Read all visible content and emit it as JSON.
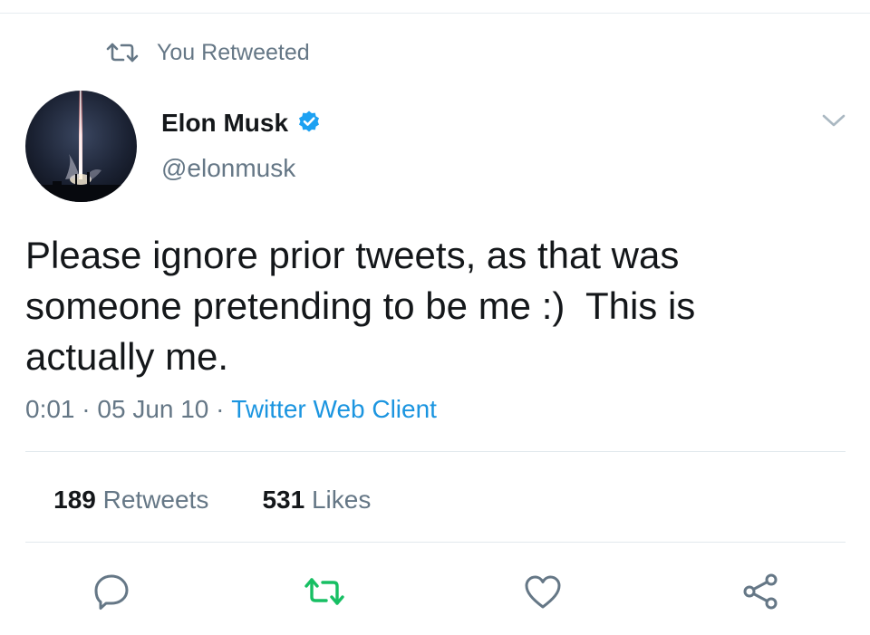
{
  "retweet_context": {
    "label": "You Retweeted",
    "icon": "retweet-icon"
  },
  "author": {
    "name": "Elon Musk",
    "handle": "@elonmusk",
    "verified": true,
    "verified_icon": "verified-badge-icon",
    "avatar": "rocket-launch-avatar"
  },
  "menu": {
    "icon": "chevron-down-icon"
  },
  "tweet": {
    "text": "Please ignore prior tweets, as that was someone pretending to be me :)  This is actually me.",
    "time": "0:01",
    "date": "05 Jun 10",
    "separator": " · ",
    "source": "Twitter Web Client"
  },
  "stats": {
    "retweets_count": "189",
    "retweets_label": " Retweets",
    "likes_count": "531",
    "likes_label": " Likes"
  },
  "actions": {
    "reply_icon": "reply-icon",
    "retweet_icon": "retweet-icon",
    "like_icon": "heart-icon",
    "share_icon": "share-icon"
  },
  "colors": {
    "secondary_text": "#657786",
    "link": "#1b95e0",
    "verified": "#1da1f2",
    "retweet_active": "#17bf63",
    "divider": "#e1e8ed"
  }
}
